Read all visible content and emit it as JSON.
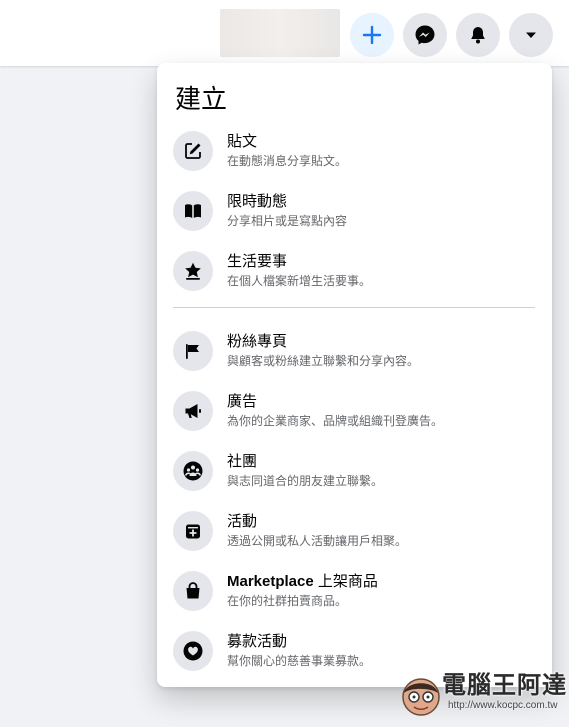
{
  "menu": {
    "title": "建立",
    "items": [
      {
        "title": "貼文",
        "desc": "在動態消息分享貼文。",
        "icon": "edit-icon"
      },
      {
        "title": "限時動態",
        "desc": "分享相片或是寫點內容",
        "icon": "book-icon"
      },
      {
        "title": "生活要事",
        "desc": "在個人檔案新增生活要事。",
        "icon": "star-icon"
      },
      {
        "title": "粉絲專頁",
        "desc": "與顧客或粉絲建立聯繫和分享內容。",
        "icon": "flag-icon"
      },
      {
        "title": "廣告",
        "desc": "為你的企業商家、品牌或組織刊登廣告。",
        "icon": "megaphone-icon"
      },
      {
        "title": "社團",
        "desc": "與志同道合的朋友建立聯繫。",
        "icon": "group-icon"
      },
      {
        "title": "活動",
        "desc": "透過公開或私人活動讓用戶相聚。",
        "icon": "calendar-plus-icon"
      },
      {
        "title": "Marketplace",
        "title_suffix": " 上架商品",
        "desc": "在你的社群拍賣商品。",
        "icon": "shopping-bag-icon"
      },
      {
        "title": "募款活動",
        "desc": "幫你關心的慈善事業募款。",
        "icon": "fundraiser-icon"
      }
    ]
  },
  "topbar": {
    "icons": [
      "plus-icon",
      "messenger-icon",
      "bell-icon",
      "caret-down-icon"
    ]
  },
  "watermark": {
    "name": "電腦王阿達",
    "url": "http://www.kocpc.com.tw"
  },
  "colors": {
    "accent": "#1877f2",
    "icon_bg": "#e4e6eb",
    "secondary_text": "#65676b"
  }
}
